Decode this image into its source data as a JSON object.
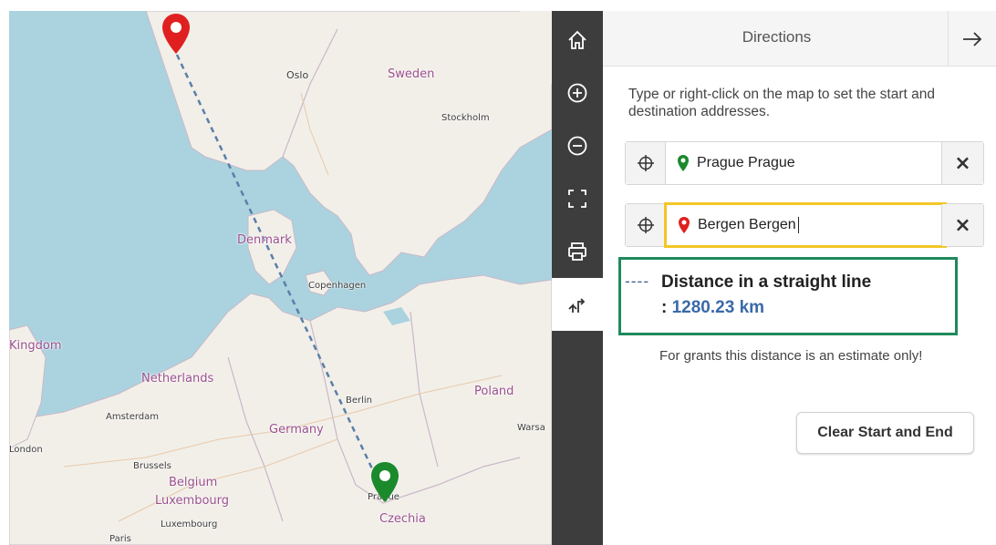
{
  "map": {
    "labels": {
      "oslo": "Oslo",
      "sweden": "Sweden",
      "stockholm": "Stockholm",
      "denmark": "Denmark",
      "copenhagen": "Copenhagen",
      "kingdom": "Kingdom",
      "netherlands": "Netherlands",
      "amsterdam": "Amsterdam",
      "berlin": "Berlin",
      "poland": "Poland",
      "warsaw": "Warsa",
      "germany": "Germany",
      "london": "London",
      "brussels": "Brussels",
      "belgium": "Belgium",
      "luxembourg_country": "Luxembourg",
      "luxembourg_city": "Luxembourg",
      "prague": "Prague",
      "czechia": "Czechia",
      "paris": "Paris"
    },
    "markers": {
      "start_color": "#1b8a2c",
      "destination_color": "#e02020",
      "route_color": "#5a7fa8"
    }
  },
  "toolbar": {
    "tools": [
      "home-icon",
      "zoom-in-icon",
      "zoom-out-icon",
      "fullscreen-icon",
      "print-icon",
      "directions-icon"
    ],
    "active": "directions-icon"
  },
  "panel": {
    "title": "Directions",
    "instructions": "Type or right-click on the map to set the start and destination addresses.",
    "start": {
      "value": "Prague  Prague",
      "clear": "×"
    },
    "destination": {
      "value": "Bergen  Bergen",
      "clear": "×"
    },
    "distance": {
      "dash": "----",
      "label": "Distance in a straight line",
      "prefix": ": ",
      "value": "1280.23 km"
    },
    "note": "For grants this distance is an estimate only!",
    "clear_button": "Clear Start and End"
  },
  "colors": {
    "focus_border": "#f3c626",
    "distance_border": "#1f8a5b",
    "distance_value": "#3a6aa8",
    "toolbar_bg": "#3d3d3d"
  }
}
